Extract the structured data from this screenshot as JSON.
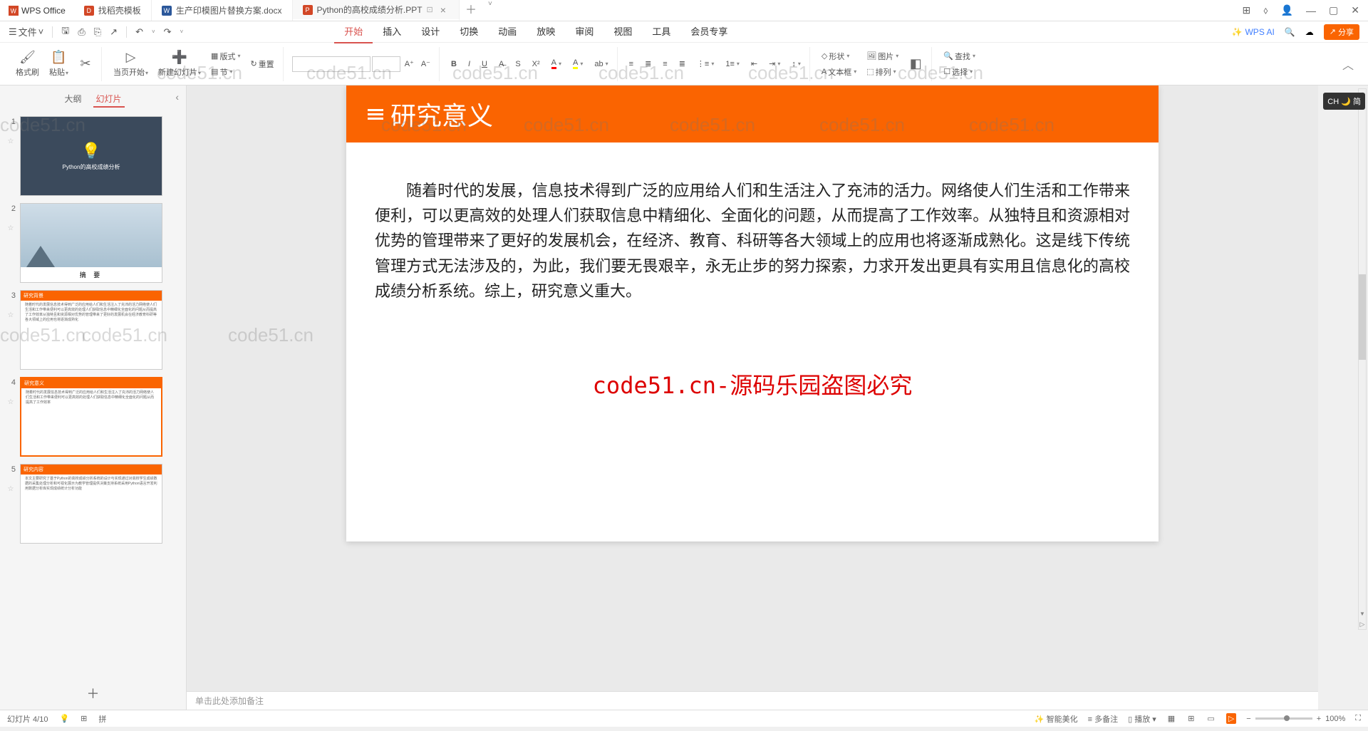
{
  "app": {
    "name": "WPS Office"
  },
  "tabs": [
    {
      "label": "找稻壳模板",
      "iconText": "D",
      "iconClass": "red"
    },
    {
      "label": "生产印模图片替换方案.docx",
      "iconText": "W",
      "iconClass": "blue"
    },
    {
      "label": "Python的高校成绩分析.PPT",
      "iconText": "P",
      "iconClass": "orange",
      "active": true
    }
  ],
  "newtab_caret": "˅",
  "qa": {
    "menu": "文件",
    "save": "🖫",
    "print": "⎙",
    "preview": "⎘",
    "undo": "↶",
    "redo": "↷"
  },
  "ribbon_tabs": [
    "开始",
    "插入",
    "设计",
    "切换",
    "动画",
    "放映",
    "审阅",
    "视图",
    "工具",
    "会员专享"
  ],
  "ribbon_active": "开始",
  "ai": "WPS AI",
  "share": "分享",
  "toolbar": {
    "format_painter": "格式刷",
    "paste": "粘贴",
    "current_start": "当页开始",
    "new_slide": "新建幻灯片",
    "layout": "版式",
    "reset": "重置",
    "section": "节",
    "shape": "形状",
    "picture": "图片",
    "textbox": "文本框",
    "arrange": "排列",
    "find": "查找",
    "select": "选择"
  },
  "side": {
    "outline": "大纲",
    "slides": "幻灯片"
  },
  "slides": [
    {
      "num": "1",
      "title": "Python的高校成绩分析"
    },
    {
      "num": "2",
      "banner": "",
      "caption": "摘    要"
    },
    {
      "num": "3",
      "banner": "研究背景"
    },
    {
      "num": "4",
      "banner": "研究意义",
      "selected": true
    },
    {
      "num": "5",
      "banner": "研究内容"
    }
  ],
  "slide": {
    "title": "研究意义",
    "body": "随着时代的发展，信息技术得到广泛的应用给人们和生活注入了充沛的活力。网络使人们生活和工作带来便利，可以更高效的处理人们获取信息中精细化、全面化的问题，从而提高了工作效率。从独特且和资源相对优势的管理带来了更好的发展机会，在经济、教育、科研等各大领域上的应用也将逐渐成熟化。这是线下传统管理方式无法涉及的，为此，我们要无畏艰辛，永无止步的努力探索，力求开发出更具有实用且信息化的高校成绩分析系统。综上，研究意义重大。",
    "wm_red": "code51.cn-源码乐园盗图必究"
  },
  "notes": "单击此处添加备注",
  "status": {
    "slide_pos": "幻灯片 4/10",
    "lang": "",
    "smart": "智能美化",
    "more": "多备注",
    "play": "播放",
    "zoom": "100%"
  },
  "ime": "CH 🌙 简",
  "watermark": "code51.cn"
}
